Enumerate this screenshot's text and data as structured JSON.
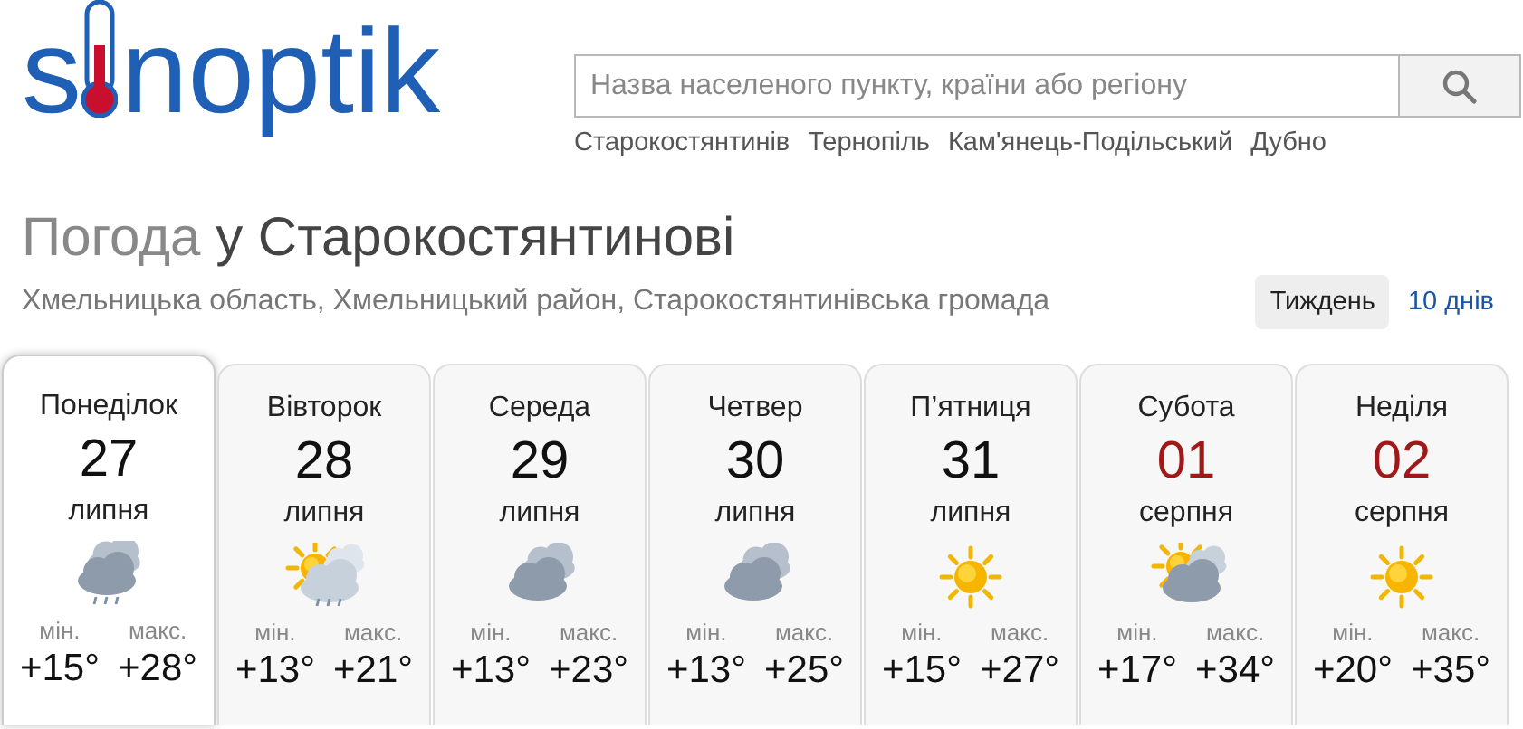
{
  "logo": {
    "before": "s",
    "after": "noptik"
  },
  "search": {
    "placeholder": "Назва населеного пункту, країни або регіону"
  },
  "cities": [
    "Старокостянтинів",
    "Тернопіль",
    "Кам'янець-Подільський",
    "Дубно"
  ],
  "title": {
    "prefix": "Погода",
    "place": "у Старокостянтинові"
  },
  "subtitle": "Хмельницька область, Хмельницький район, Старокостянтинівська громада",
  "period_tabs": [
    {
      "label": "Тиждень",
      "selected": true
    },
    {
      "label": "10 днів",
      "selected": false
    }
  ],
  "days": [
    {
      "name": "Понеділок",
      "date": "27",
      "month": "липня",
      "weekend": false,
      "selected": true,
      "kind": "cloudy-rain",
      "min_label": "мін.",
      "max_label": "макс.",
      "min": "+15°",
      "max": "+28°"
    },
    {
      "name": "Вівторок",
      "date": "28",
      "month": "липня",
      "weekend": false,
      "selected": false,
      "kind": "partly-sunny-rain",
      "min_label": "мін.",
      "max_label": "макс.",
      "min": "+13°",
      "max": "+21°"
    },
    {
      "name": "Середа",
      "date": "29",
      "month": "липня",
      "weekend": false,
      "selected": false,
      "kind": "cloudy",
      "min_label": "мін.",
      "max_label": "макс.",
      "min": "+13°",
      "max": "+23°"
    },
    {
      "name": "Четвер",
      "date": "30",
      "month": "липня",
      "weekend": false,
      "selected": false,
      "kind": "cloudy",
      "min_label": "мін.",
      "max_label": "макс.",
      "min": "+13°",
      "max": "+25°"
    },
    {
      "name": "П’ятниця",
      "date": "31",
      "month": "липня",
      "weekend": false,
      "selected": false,
      "kind": "sunny",
      "min_label": "мін.",
      "max_label": "макс.",
      "min": "+15°",
      "max": "+27°"
    },
    {
      "name": "Субота",
      "date": "01",
      "month": "серпня",
      "weekend": true,
      "selected": false,
      "kind": "partly-sunny",
      "min_label": "мін.",
      "max_label": "макс.",
      "min": "+17°",
      "max": "+34°"
    },
    {
      "name": "Неділя",
      "date": "02",
      "month": "серпня",
      "weekend": true,
      "selected": false,
      "kind": "sunny",
      "min_label": "мін.",
      "max_label": "макс.",
      "min": "+20°",
      "max": "+35°"
    }
  ]
}
